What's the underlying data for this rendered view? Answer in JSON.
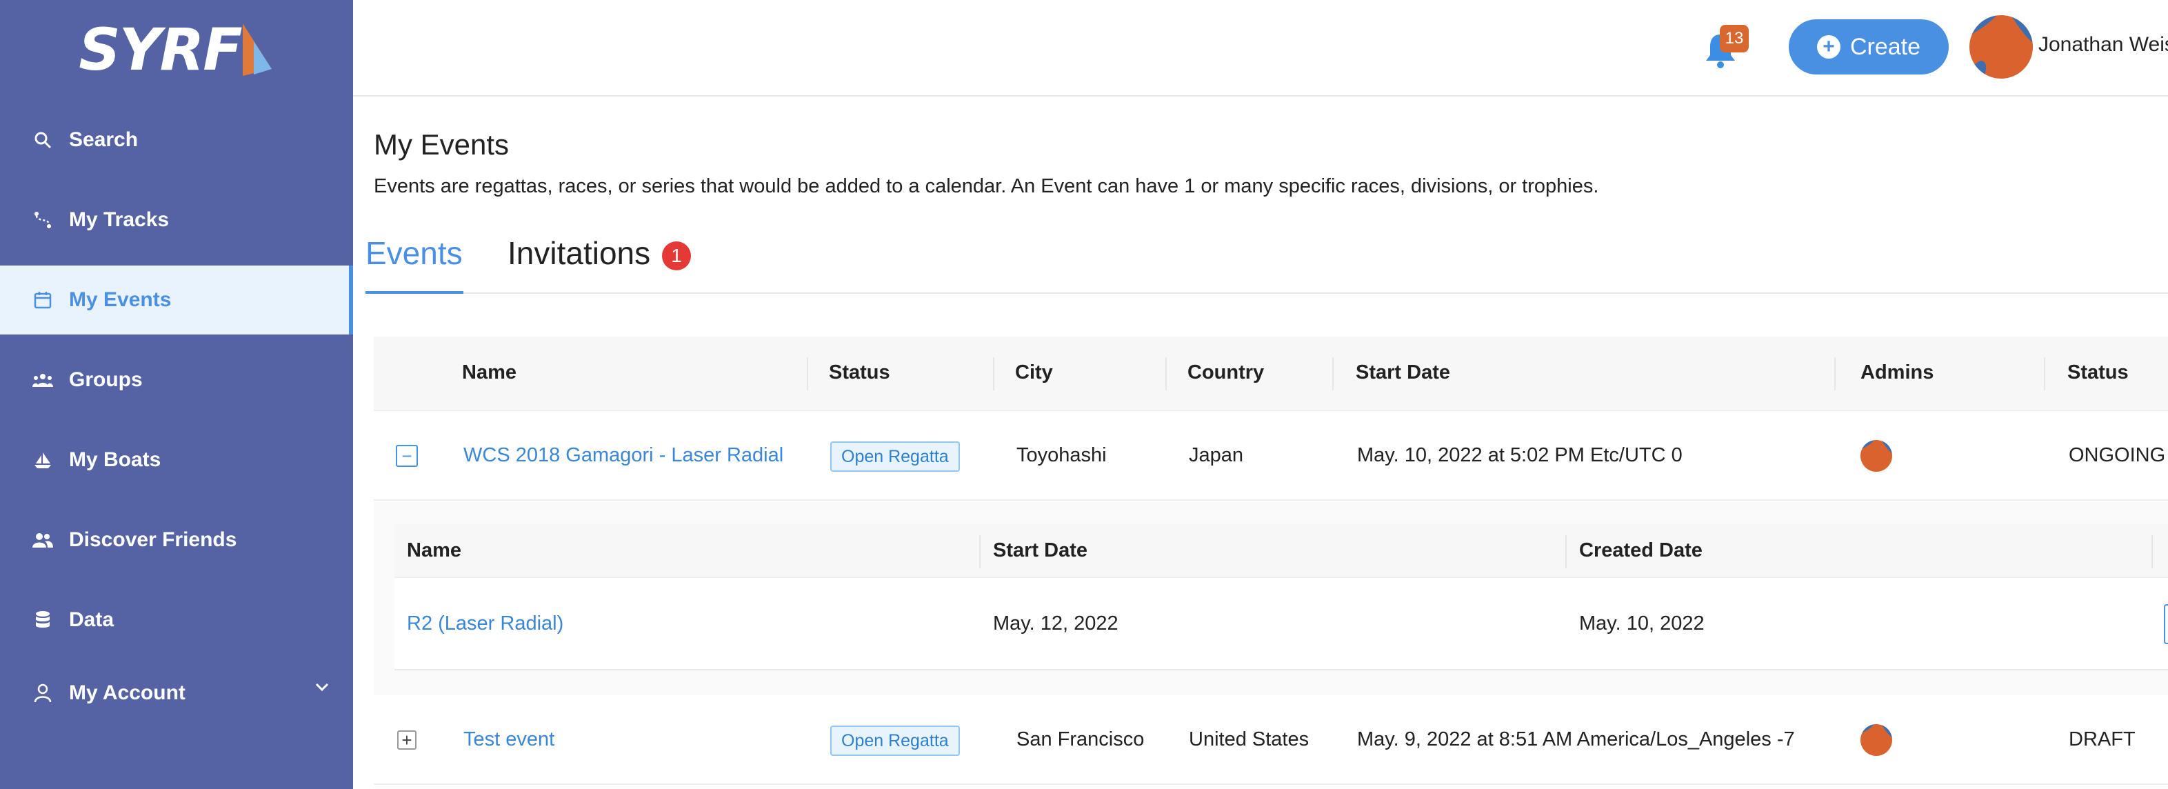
{
  "brand": {
    "name": "SYRF"
  },
  "sidebar": {
    "items": [
      {
        "label": "Search",
        "icon": "search-icon"
      },
      {
        "label": "My Tracks",
        "icon": "tracks-icon"
      },
      {
        "label": "My Events",
        "icon": "calendar-icon",
        "active": true
      },
      {
        "label": "Groups",
        "icon": "groups-icon"
      },
      {
        "label": "My Boats",
        "icon": "boat-icon"
      },
      {
        "label": "Discover Friends",
        "icon": "friends-icon"
      },
      {
        "label": "Data",
        "icon": "database-icon"
      },
      {
        "label": "My Account",
        "icon": "user-icon"
      }
    ]
  },
  "header": {
    "notification_count": "13",
    "create_label": "Create",
    "user_name": "Jonathan Weiss"
  },
  "page": {
    "title": "My Events",
    "description": "Events are regattas, races, or series that would be added to a calendar. An Event can have 1 or many specific races, divisions, or trophies.",
    "tabs": [
      {
        "label": "Events",
        "active": true
      },
      {
        "label": "Invitations",
        "badge": "1"
      }
    ]
  },
  "table": {
    "columns": [
      "Name",
      "Status",
      "City",
      "Country",
      "Start Date",
      "Admins",
      "Status"
    ],
    "rows": [
      {
        "name": "WCS 2018 Gamagori - Laser Radial",
        "status": "Open Regatta",
        "city": "Toyohashi",
        "country": "Japan",
        "start_date": "May. 10, 2022 at 5:02 PM Etc/UTC 0",
        "state": "ONGOING",
        "expanded": true
      },
      {
        "name": "Test event",
        "status": "Open Regatta",
        "city": "San Francisco",
        "country": "United States",
        "start_date": "May. 9, 2022 at 8:51 AM America/Los_Angeles -7",
        "state": "DRAFT",
        "expanded": false
      }
    ]
  },
  "subtable": {
    "columns": [
      "Name",
      "Start Date",
      "Created Date"
    ],
    "rows": [
      {
        "name": "R2 (Laser Radial)",
        "start_date": "May. 12, 2022",
        "created_date": "May. 10, 2022"
      }
    ]
  },
  "colors": {
    "sidebar": "#5563a4",
    "accent": "#4a90e2",
    "badge_orange": "#d9682e",
    "badge_red": "#e53935"
  }
}
